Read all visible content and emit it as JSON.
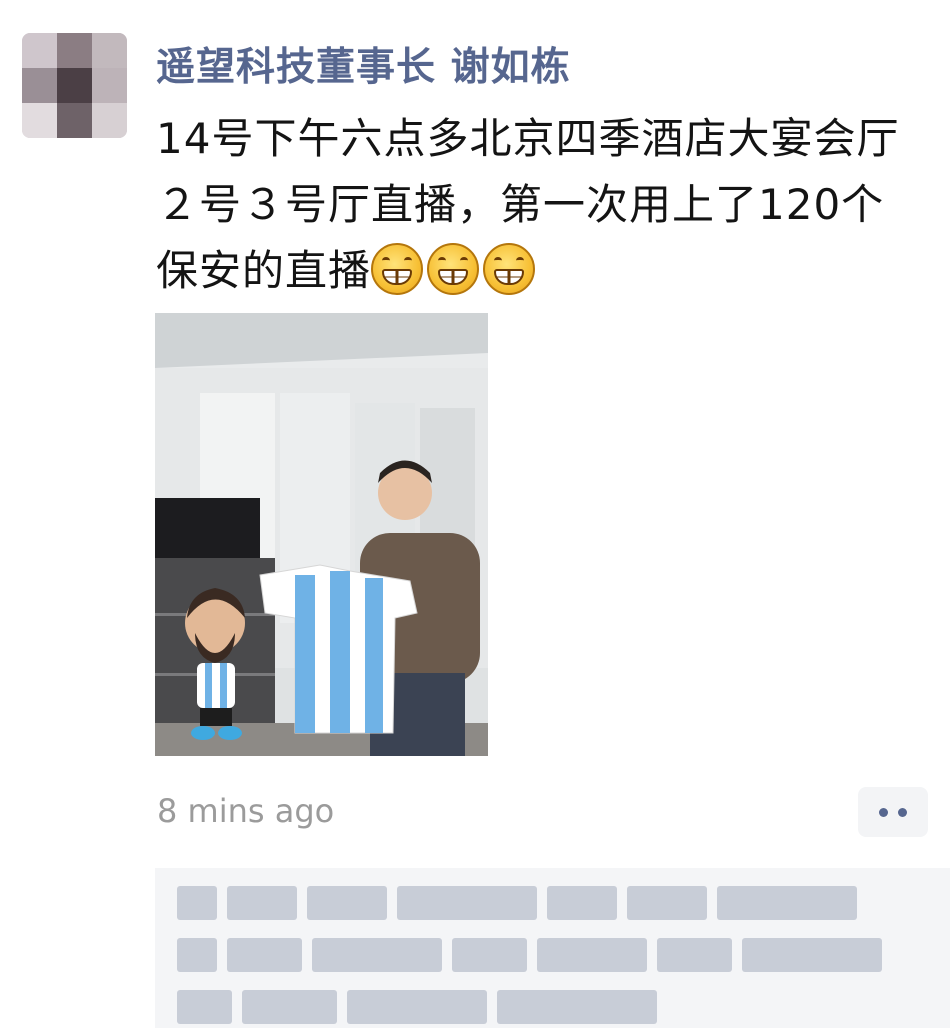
{
  "post": {
    "author": "遥望科技董事长 谢如栋",
    "text": "14号下午六点多北京四季酒店大宴会厅２号３号厅直播，第一次用上了120个保安的直播",
    "emoji_count": 3,
    "emoji_icon": "grin-icon",
    "timestamp": "8 mins ago",
    "more_icon": "more-dots-icon"
  },
  "colors": {
    "author_name": "#56668f",
    "body_text": "#141414",
    "timestamp": "#9b9b9b",
    "comment_bg": "#f4f5f7"
  }
}
